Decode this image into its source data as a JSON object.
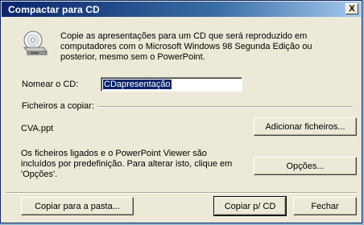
{
  "window": {
    "title": "Compactar para CD",
    "close_glyph": "X"
  },
  "intro": {
    "icon": "cd-drive-icon",
    "text": "Copie as apresentações para um CD que será reproduzido em computadores com o Microsoft Windows 98 Segunda Edição ou posterior, mesmo sem o PowerPoint."
  },
  "name_cd": {
    "label": "Nomear o CD:",
    "value": "CDapresentação"
  },
  "files": {
    "group_label": "Ficheiros a copiar:",
    "file_name": "CVA.ppt",
    "add_button": "Adicionar ficheiros...",
    "viewer_text": "Os ficheiros ligados e o PowerPoint Viewer são incluídos por predefinição. Para alterar isto, clique em 'Opções'.",
    "options_button": "Opções..."
  },
  "footer": {
    "copy_folder_button": "Copiar para a pasta...",
    "copy_cd_button": "Copiar p/ CD",
    "close_button": "Fechar"
  },
  "colors": {
    "titlebar_start": "#0a246a",
    "titlebar_end": "#a6caf0",
    "dialog_bg": "#ece9d8",
    "selection": "#0a246a"
  }
}
